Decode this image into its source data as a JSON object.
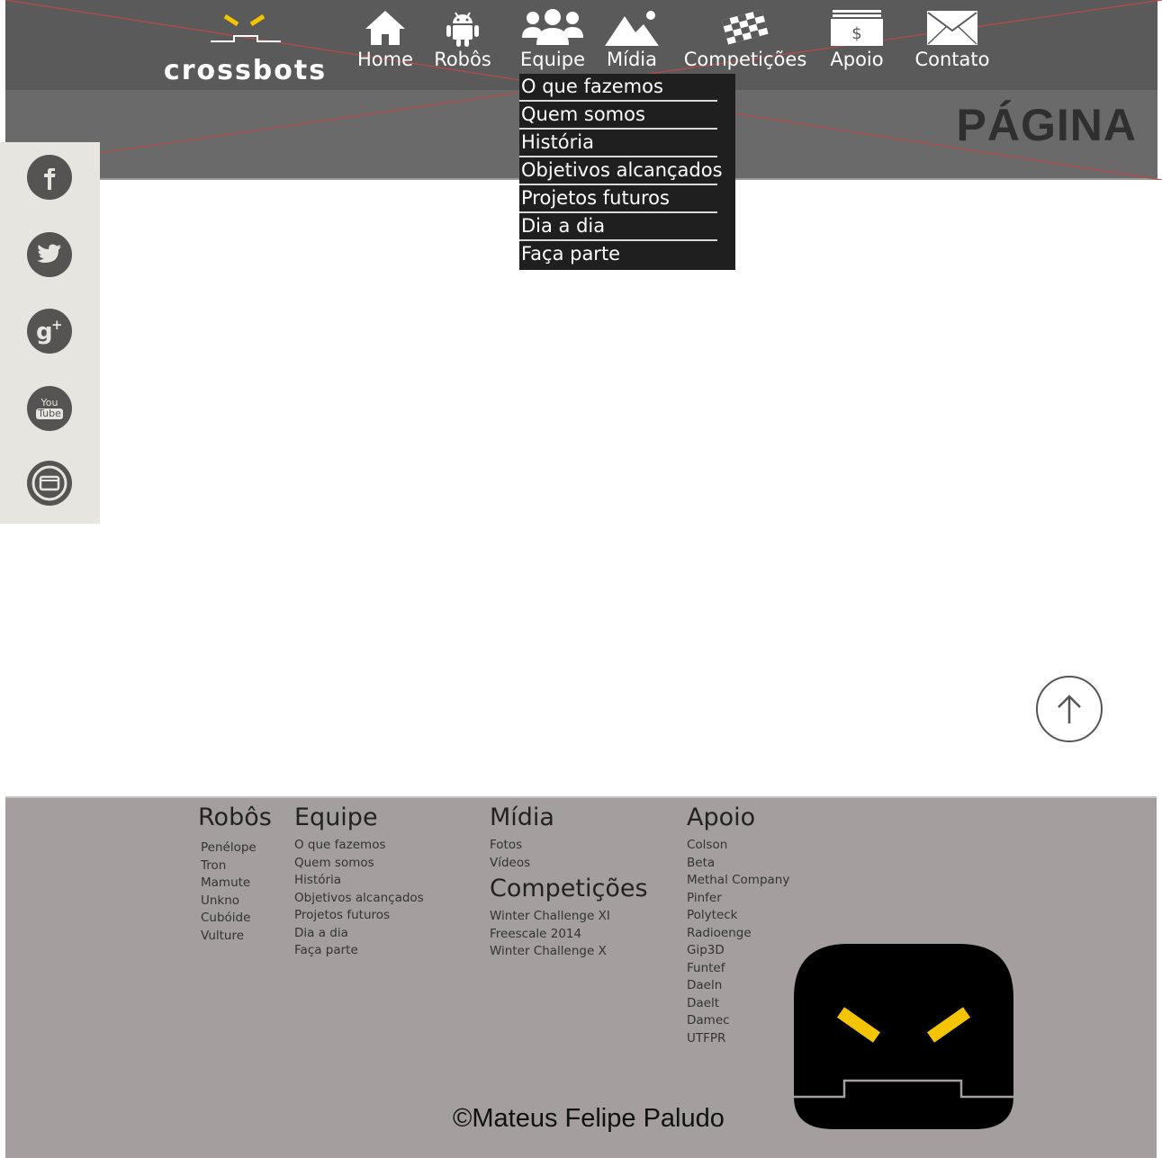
{
  "brand": {
    "name": "crossbots",
    "accent": "#f5c400"
  },
  "nav": {
    "items": [
      {
        "label": "Home",
        "icon": "home-icon"
      },
      {
        "label": "Robôs",
        "icon": "android-icon"
      },
      {
        "label": "Equipe",
        "icon": "people-icon"
      },
      {
        "label": "Mídia",
        "icon": "mountain-icon"
      },
      {
        "label": "Competições",
        "icon": "checkered-flag-icon"
      },
      {
        "label": "Apoio",
        "icon": "money-icon"
      },
      {
        "label": "Contato",
        "icon": "envelope-icon"
      }
    ]
  },
  "dropdown": {
    "items": [
      "O que fazemos",
      "Quem somos",
      "História",
      "Objetivos alcançados",
      "Projetos futuros",
      "Dia a dia",
      "Faça parte"
    ]
  },
  "banner": {
    "title": "PÁGINA"
  },
  "social": {
    "icons": [
      "facebook-icon",
      "twitter-icon",
      "google-plus-icon",
      "youtube-icon",
      "mail-icon"
    ],
    "youtube_top": "You",
    "youtube_bottom": "Tube"
  },
  "back_to_top": {
    "icon": "arrow-up-icon"
  },
  "footer": {
    "robos": {
      "title": "Robôs",
      "links": [
        "Penélope",
        "Tron",
        "Mamute",
        "Unkno",
        "Cubóide",
        "Vulture"
      ]
    },
    "equipe": {
      "title": "Equipe",
      "links": [
        "O que fazemos",
        "Quem somos",
        "História",
        "Objetivos alcançados",
        "Projetos futuros",
        "Dia a dia",
        "Faça parte"
      ]
    },
    "midia": {
      "title": "Mídia",
      "links": [
        "Fotos",
        "Vídeos"
      ]
    },
    "competicoes": {
      "title": "Competições",
      "links": [
        "Winter Challenge XI",
        "Freescale 2014",
        "Winter Challenge X"
      ]
    },
    "apoio": {
      "title": "Apoio",
      "links": [
        "Colson",
        "Beta",
        "Methal Company",
        "Pinfer",
        "Polyteck",
        "Radioenge",
        "Gip3D",
        "Funtef",
        "Daeln",
        "Daelt",
        "Damec",
        "UTFPR"
      ]
    },
    "copyright": "©Mateus Felipe Paludo"
  }
}
